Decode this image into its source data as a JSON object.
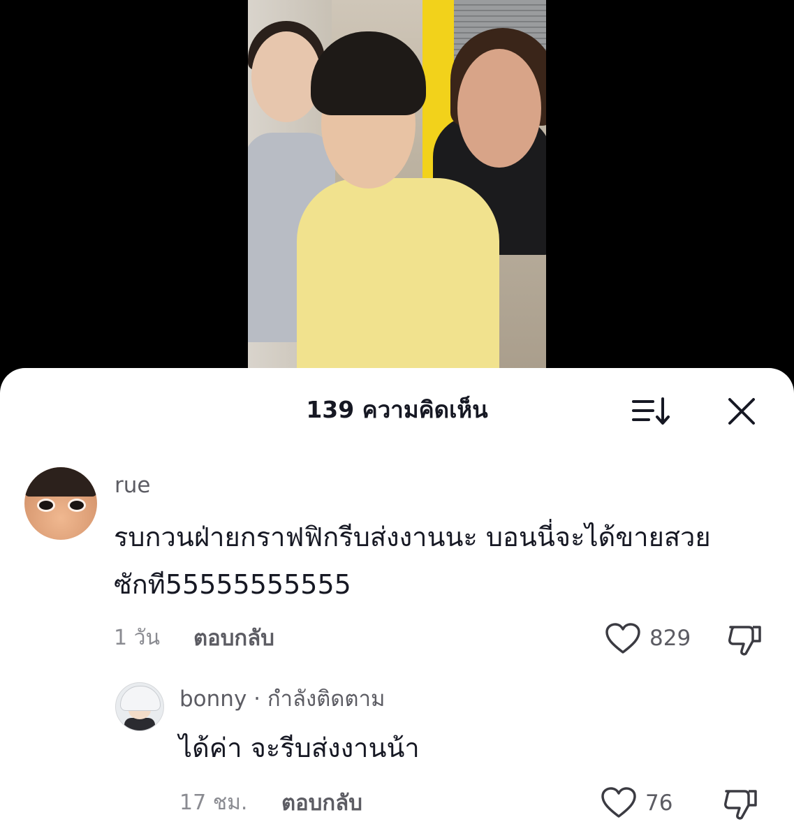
{
  "header": {
    "title": "139 ความคิดเห็น",
    "sort_icon": "sort-icon",
    "close_icon": "close-icon"
  },
  "comments": [
    {
      "username": "rue",
      "text_line1": "รบกวนฝ่ายกราฟฟิกรีบส่งงานนะ บอนนี่จะได้ขายสวย",
      "text_line2": "ซักที55555555555",
      "time": "1 วัน",
      "reply_label": "ตอบกลับ",
      "likes": "829",
      "avatar_icon": "avatar-rue"
    }
  ],
  "replies": [
    {
      "username": "bonny",
      "follow_status": " · กำลังติดตาม",
      "text": "ได้ค่า จะรีบส่งงานน้า",
      "time": "17 ชม.",
      "reply_label": "ตอบกลับ",
      "likes": "76",
      "avatar_icon": "avatar-bonny"
    }
  ],
  "colors": {
    "primary_text": "#161823",
    "secondary_text": "#5c5c63",
    "time_text": "#8a8b91",
    "sheet_background": "#ffffff",
    "video_background": "#000000"
  }
}
